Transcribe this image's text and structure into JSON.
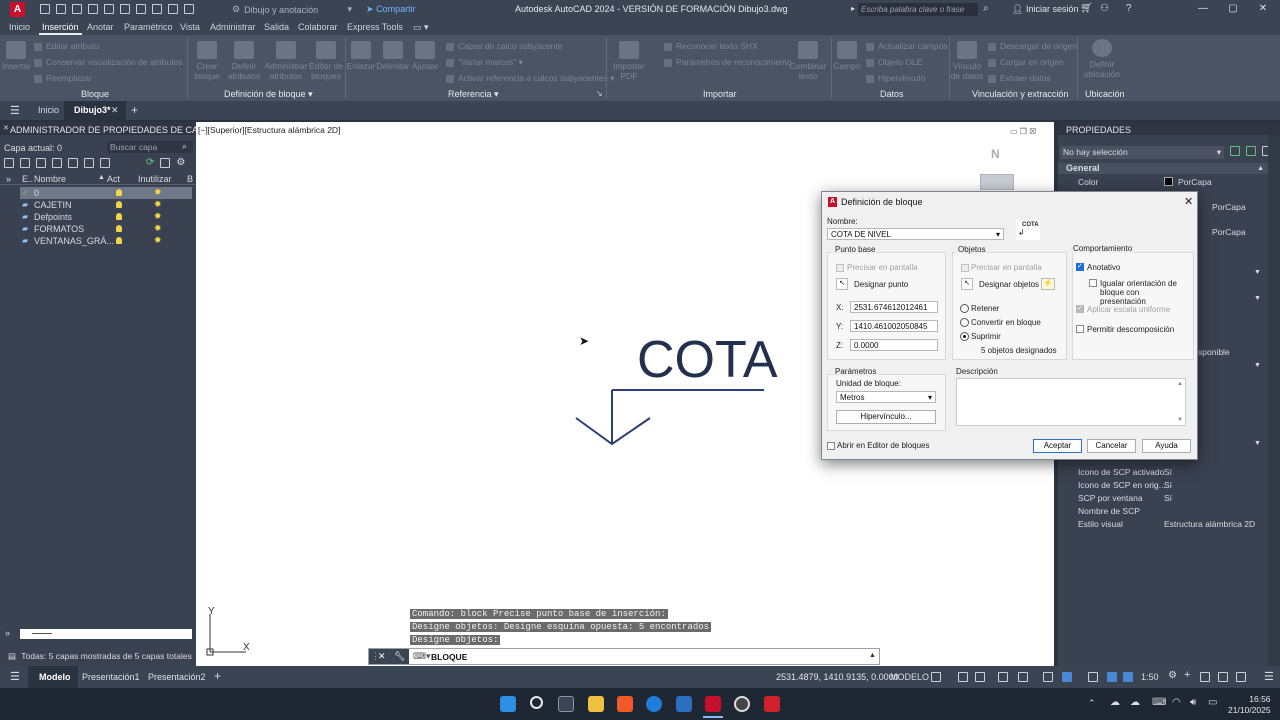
{
  "titlebar": {
    "logo": "A",
    "workspace": "Dibujo y anotación",
    "share": "Compartir",
    "title": "Autodesk AutoCAD 2024 - VERSIÓN DE FORMACIÓN   Dibujo3.dwg",
    "search_placeholder": "Escriba palabra clave o frase",
    "signin": "Iniciar sesión"
  },
  "menu_tabs": [
    "Inicio",
    "Inserción",
    "Anotar",
    "Paramétrico",
    "Vista",
    "Administrar",
    "Salida",
    "Colaborar",
    "Express Tools"
  ],
  "ribbon": {
    "groups": [
      "Bloque",
      "Definición de bloque",
      "Referencia",
      "Importar",
      "Datos",
      "Vinculación y extracción",
      "Ubicación"
    ],
    "bloque_small": [
      "Editar atributo",
      "Conservar visualización de atributos",
      "Reemplazar"
    ],
    "bloque_big": [
      "Insertar"
    ],
    "defblock_big": [
      "Crear bloque",
      "Definir atributos",
      "Administrar atributos",
      "Editor de bloques"
    ],
    "ref_big": [
      "Enlazar",
      "Delimitar",
      "Ajustar"
    ],
    "ref_small": [
      "Capas de calco subyacente",
      "\"Variar marcos\"",
      "Activar referencia a calcos subyacentes"
    ],
    "import_big": [
      "Importar PDF"
    ],
    "import_small": [
      "Reconocer texto SHX",
      "Parámetros de reconocimiento"
    ],
    "combine": "Combinar texto",
    "datos_big": [
      "Campo"
    ],
    "datos_small": [
      "Actualizar campos",
      "Objeto OLE",
      "Hipervínculo"
    ],
    "vinc_big": [
      "Vínculo de datos"
    ],
    "vinc_small": [
      "Descargar de origen",
      "Cargar en origen",
      "Extraer datos"
    ],
    "ubic_big": [
      "Definir ubicación"
    ]
  },
  "file_tabs": [
    "Inicio",
    "Dibujo3*"
  ],
  "layer_panel": {
    "title": "ADMINISTRADOR DE PROPIEDADES DE CA...",
    "current": "Capa actual: 0",
    "search_placeholder": "Buscar capa",
    "headers": [
      "E..",
      "Nombre",
      "Act",
      "Inutilizar",
      "B"
    ],
    "layers": [
      {
        "name": "0",
        "selected": true
      },
      {
        "name": "CAJETIN",
        "selected": false
      },
      {
        "name": "Defpoints",
        "selected": false
      },
      {
        "name": "FORMATOS",
        "selected": false
      },
      {
        "name": "VENTANAS_GRÁ...",
        "selected": false
      }
    ],
    "footer": "Todas: 5 capas mostradas de 5 capas totales"
  },
  "canvas": {
    "viewport_label": "[−][Superior][Estructura alámbrica 2D]",
    "compass_n": "N",
    "drawing_text": "COTA",
    "command_history": [
      "Comando:  block Precise punto base de inserción:",
      "Designe objetos: Designe esquina opuesta: 5 encontrados",
      "Designe objetos:"
    ],
    "command_current": "BLOQUE",
    "ucs_x": "X",
    "ucs_y": "Y"
  },
  "properties": {
    "title": "PROPIEDADES",
    "selection": "No hay selección",
    "general": "General",
    "color_label": "Color",
    "color_value": "PorCapa",
    "partial_values": [
      "PorCapa",
      "PorCapa",
      "sponible"
    ],
    "rows": [
      {
        "label": "Icono de SCP activado",
        "value": "Sí"
      },
      {
        "label": "Icono de SCP en orig...",
        "value": "Sí"
      },
      {
        "label": "SCP por ventana",
        "value": "Sí"
      },
      {
        "label": "Nombre de SCP",
        "value": ""
      },
      {
        "label": "Estilo visual",
        "value": "Estructura alámbrica 2D"
      }
    ]
  },
  "dialog": {
    "title": "Definición de bloque",
    "name_label": "Nombre:",
    "name_value": "COTA DE NIVEL",
    "preview_text": "COTA",
    "base_point": {
      "title": "Punto base",
      "specify_onscreen": "Precisar en pantalla",
      "pick_button": "Designar punto",
      "x_label": "X:",
      "x": "2531.674612012461",
      "y_label": "Y:",
      "y": "1410.461002050845",
      "z_label": "Z:",
      "z": "0.0000"
    },
    "objects": {
      "title": "Objetos",
      "specify_onscreen": "Precisar en pantalla",
      "select_button": "Designar objetos",
      "retain": "Retener",
      "convert": "Convertir en bloque",
      "delete": "Suprimir",
      "count": "5 objetos designados"
    },
    "behavior": {
      "title": "Comportamiento",
      "annotative": "Anotativo",
      "match_orientation": "Igualar orientación de bloque con presentación",
      "scale_uniformly": "Aplicar escala uniforme",
      "allow_explode": "Permitir descomposición"
    },
    "settings": {
      "title": "Parámetros",
      "unit_label": "Unidad de bloque:",
      "unit_value": "Metros",
      "hyperlink": "Hipervínculo..."
    },
    "description_label": "Descripción",
    "open_in_editor": "Abrir en Editor de bloques",
    "ok": "Aceptar",
    "cancel": "Cancelar",
    "help": "Ayuda"
  },
  "statusbar": {
    "tabs": [
      "Modelo",
      "Presentación1",
      "Presentación2"
    ],
    "coords": "2531.4879, 1410.9135, 0.0000",
    "mode": "MODELO",
    "scale": "1:50"
  },
  "taskbar": {
    "time": "16:56",
    "date": "21/10/2025"
  },
  "colors": {
    "accent": "#1f6fd1",
    "cota_blue": "#23304d",
    "autocad_red": "#c8102e"
  }
}
